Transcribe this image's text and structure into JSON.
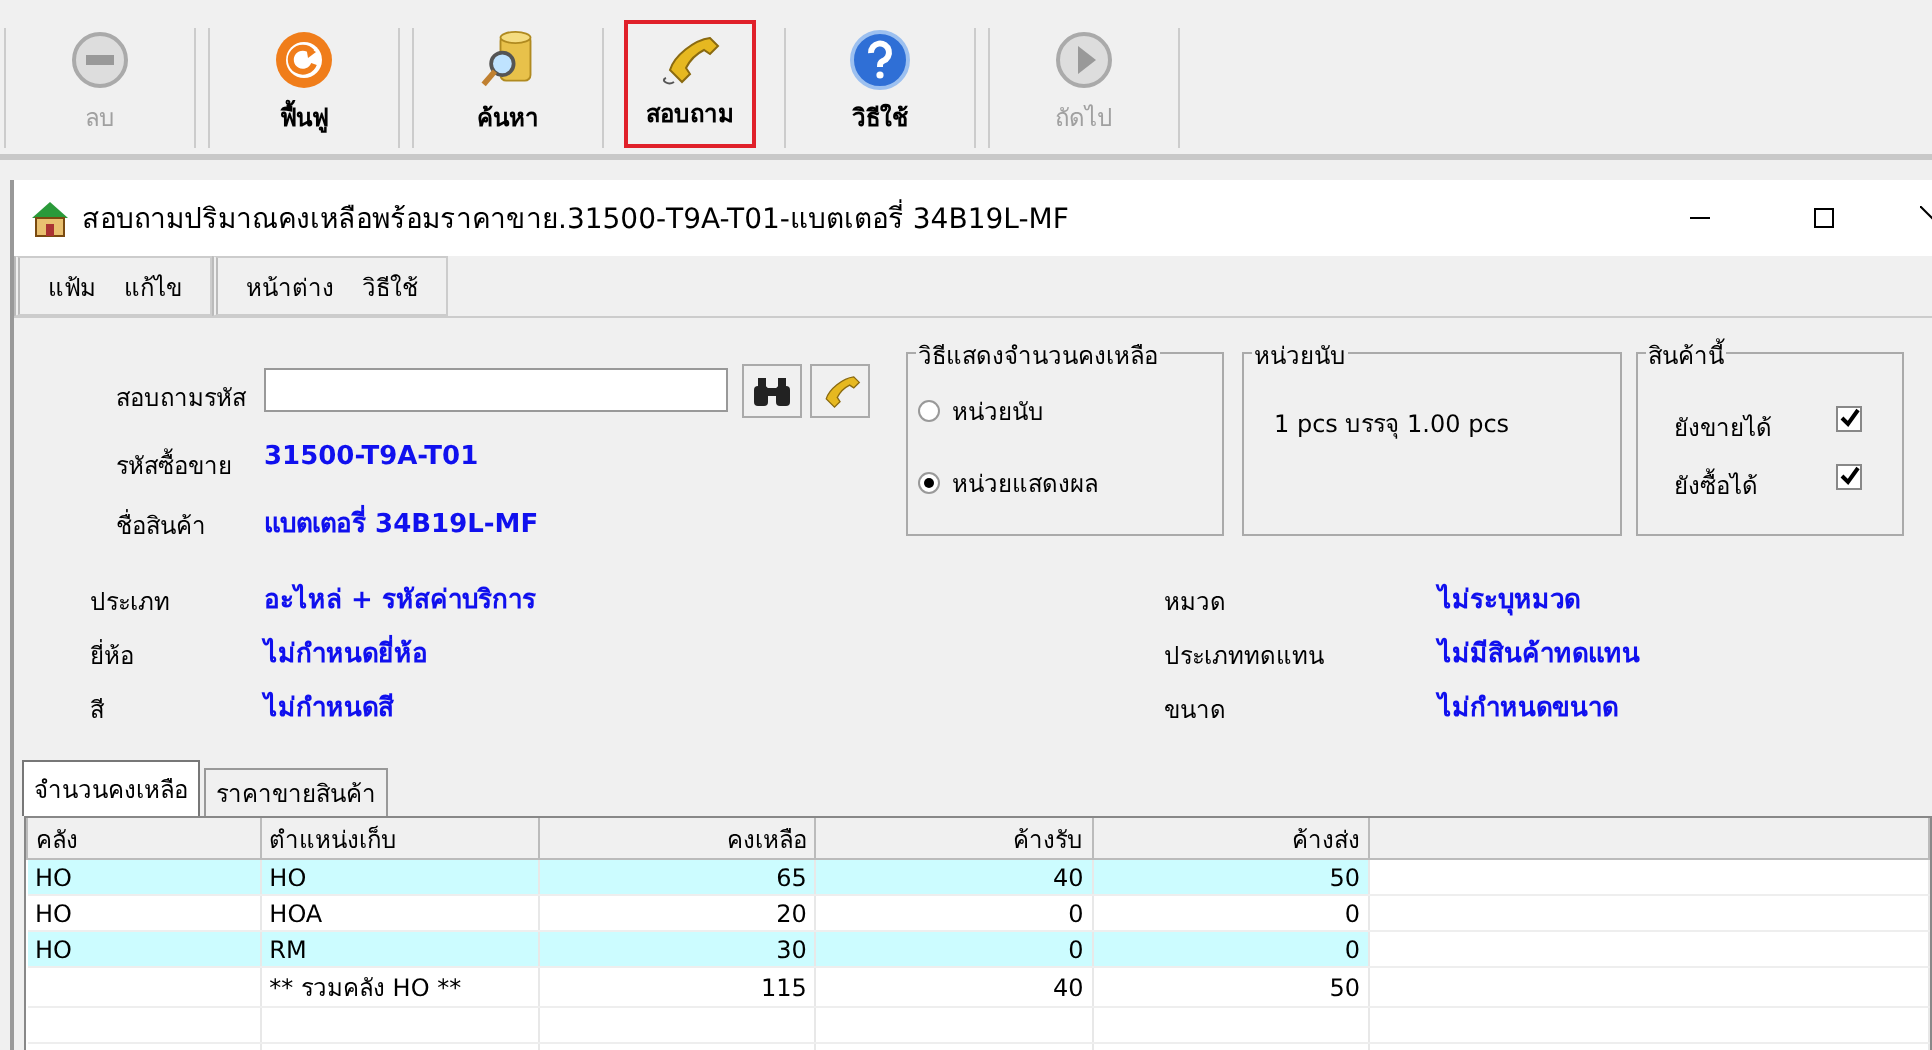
{
  "toolbar": [
    {
      "label": "ลบ",
      "disabled": true,
      "highlighted": false
    },
    {
      "label": "ฟื้นฟู",
      "disabled": false,
      "highlighted": false
    },
    {
      "label": "ค้นหา",
      "disabled": false,
      "highlighted": false
    },
    {
      "label": "สอบถาม",
      "disabled": false,
      "highlighted": true
    },
    {
      "label": "วิธีใช้",
      "disabled": false,
      "highlighted": false
    },
    {
      "label": "ถัดไป",
      "disabled": true,
      "highlighted": false
    }
  ],
  "window": {
    "title": "สอบถามปริมาณคงเหลือพร้อมราคาขาย.31500-T9A-T01-แบตเตอรี่ 34B19L-MF"
  },
  "menu_groups": [
    [
      "แฟ้ม",
      "แก้ไข"
    ],
    [
      "หน้าต่าง",
      "วิธีใช้"
    ]
  ],
  "query": {
    "label": "สอบถามรหัส"
  },
  "product": [
    {
      "label": "รหัสซื้อขาย",
      "value": "31500-T9A-T01"
    },
    {
      "label": "ชื่อสินค้า",
      "value": "แบตเตอรี่ 34B19L-MF"
    }
  ],
  "display_mode": {
    "title": "วิธีแสดงจำนวนคงเหลือ",
    "options": [
      {
        "label": "หน่วยนับ",
        "selected": false
      },
      {
        "label": "หน่วยแสดงผล",
        "selected": true
      }
    ]
  },
  "unit": {
    "title": "หน่วยนับ",
    "text": "1 pcs บรรจุ 1.00 pcs"
  },
  "this_product": {
    "title": "สินค้านี้",
    "options": [
      {
        "label": "ยังขายได้",
        "checked": true
      },
      {
        "label": "ยังซื้อได้",
        "checked": true
      }
    ]
  },
  "details_left": [
    {
      "label": "ประเภท",
      "value": "อะไหล่ + รหัสค่าบริการ"
    },
    {
      "label": "ยี่ห้อ",
      "value": "ไม่กำหนดยี่ห้อ"
    },
    {
      "label": "สี",
      "value": "ไม่กำหนดสี"
    }
  ],
  "details_right": [
    {
      "label": "หมวด",
      "value": "ไม่ระบุหมวด"
    },
    {
      "label": "ประเภททดแทน",
      "value": "ไม่มีสินค้าทดแทน"
    },
    {
      "label": "ขนาด",
      "value": "ไม่กำหนดขนาด"
    }
  ],
  "tabs": [
    {
      "label": "จำนวนคงเหลือ",
      "selected": true
    },
    {
      "label": "ราคาขายสินค้า",
      "selected": false
    }
  ],
  "table": {
    "columns": [
      "คลัง",
      "ตำแหน่งเก็บ",
      "คงเหลือ",
      "ค้างรับ",
      "ค้างส่ง"
    ],
    "rows": [
      {
        "cells": [
          "HO",
          "HO",
          "65",
          "40",
          "50"
        ],
        "highlighted": true
      },
      {
        "cells": [
          "HO",
          "HOA",
          "20",
          "0",
          "0"
        ],
        "highlighted": false
      },
      {
        "cells": [
          "HO",
          "RM",
          "30",
          "0",
          "0"
        ],
        "highlighted": true
      },
      {
        "cells": [
          "",
          "** รวมคลัง HO **",
          "115",
          "40",
          "50"
        ],
        "highlighted": false
      }
    ]
  }
}
